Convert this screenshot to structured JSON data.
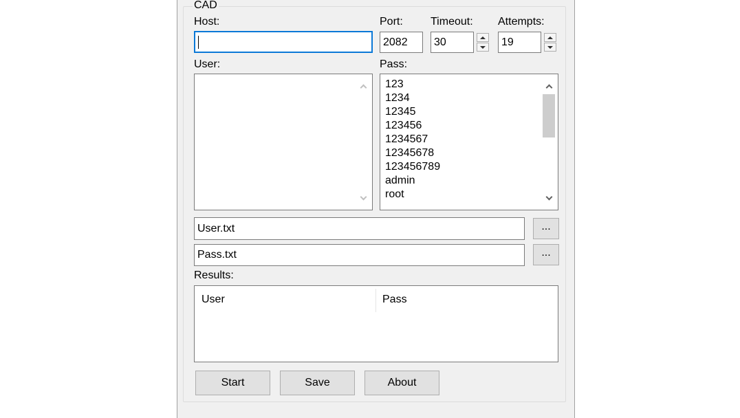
{
  "group": {
    "title": "CAD"
  },
  "host": {
    "label": "Host:",
    "value": ""
  },
  "port": {
    "label": "Port:",
    "value": "2082"
  },
  "timeout": {
    "label": "Timeout:",
    "value": "30"
  },
  "attempts": {
    "label": "Attempts:",
    "value": "19"
  },
  "user": {
    "label": "User:",
    "items": []
  },
  "pass": {
    "label": "Pass:",
    "items": [
      "123",
      "1234",
      "12345",
      "123456",
      "1234567",
      "12345678",
      "123456789",
      "admin",
      "root"
    ]
  },
  "user_file": {
    "value": "User.txt",
    "browse_label": "..."
  },
  "pass_file": {
    "value": "Pass.txt",
    "browse_label": "..."
  },
  "results": {
    "label": "Results:",
    "columns": [
      "User",
      "Pass"
    ]
  },
  "buttons": {
    "start": "Start",
    "save": "Save",
    "about": "About"
  },
  "colors": {
    "window_bg": "#f0f0f0",
    "focus_border": "#0a78d7",
    "button_bg": "#e1e1e1"
  }
}
